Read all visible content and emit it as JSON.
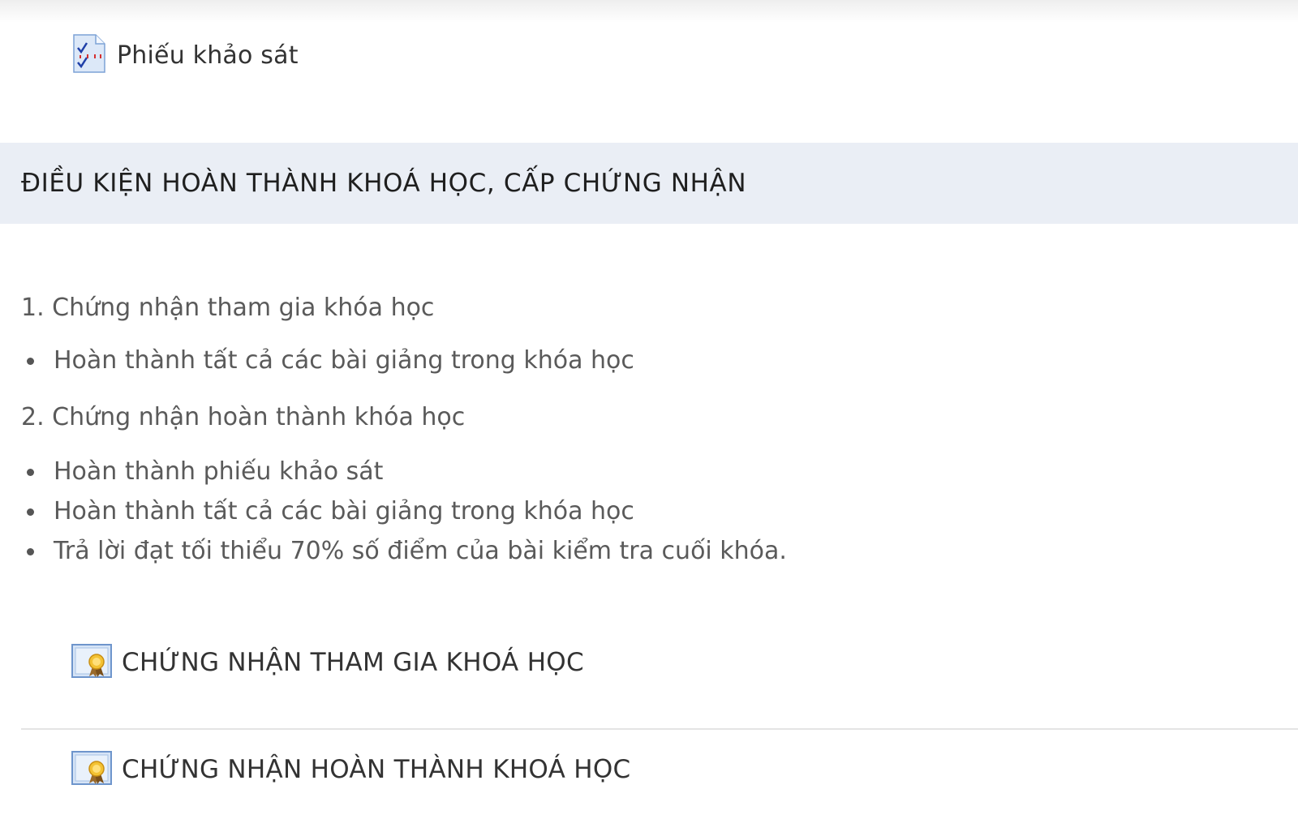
{
  "activities": {
    "survey": {
      "label": "Phiếu khảo sát",
      "icon": "survey-checklist-icon"
    },
    "cert_participation": {
      "label": "CHỨNG NHẬN THAM GIA KHOÁ HỌC",
      "icon": "certificate-award-icon"
    },
    "cert_completion": {
      "label": "CHỨNG NHẬN HOÀN THÀNH KHOÁ HỌC",
      "icon": "certificate-award-icon"
    }
  },
  "section": {
    "title": "ĐIỀU KIỆN HOÀN THÀNH KHOÁ HỌC, CẤP CHỨNG NHẬN",
    "summary": {
      "item1_title": "1. Chứng nhận tham gia khóa học",
      "item1_bullets": [
        "Hoàn thành tất cả các bài giảng trong khóa học"
      ],
      "item2_title": "2. Chứng nhận hoàn thành khóa học",
      "item2_bullets": [
        "Hoàn thành phiếu khảo sát",
        "Hoàn thành tất cả các bài giảng trong khóa học",
        "Trả lời đạt tối thiểu 70% số điểm của bài kiểm tra cuối khóa."
      ]
    }
  },
  "colors": {
    "header_bg": "#eaeef5",
    "text_dark": "#333333",
    "text_muted": "#5a5a5a",
    "divider": "#e4e4e4"
  }
}
